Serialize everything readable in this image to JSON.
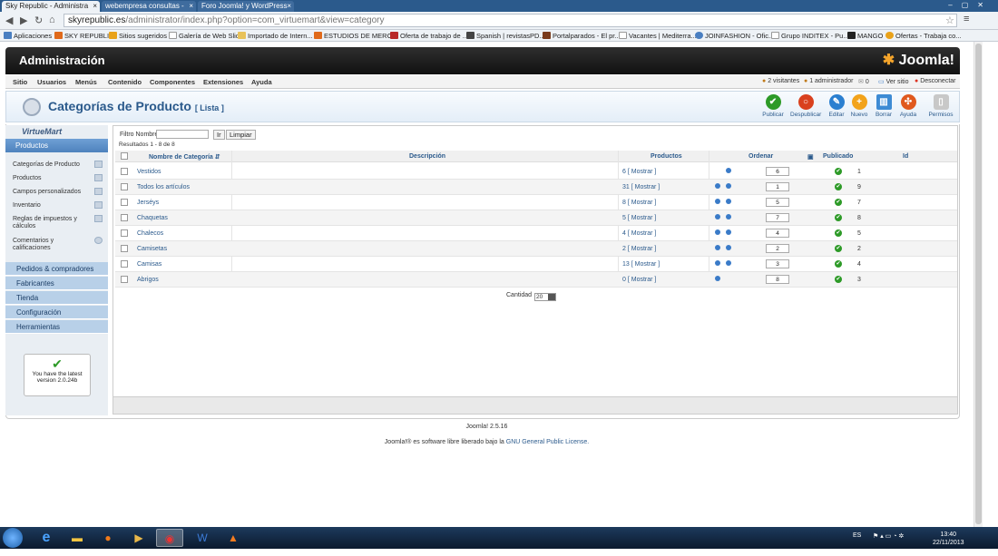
{
  "browser": {
    "tabs": [
      {
        "label": "Sky Republic - Administra",
        "active": true
      },
      {
        "label": "webempresa consultas - ",
        "active": false
      },
      {
        "label": "Foro Joomla! y WordPress",
        "active": false
      }
    ],
    "url_host": "skyrepublic.es",
    "url_path": "/administrator/index.php?option=com_virtuemart&view=category",
    "bookmarks": [
      "Aplicaciones",
      "SKY REPUBLIC",
      "Sitios sugeridos",
      "Galería de Web Slice",
      "Importado de Intern...",
      "ESTUDIOS DE MERC...",
      "Oferta de trabajo de ...",
      "Spanish | revistasPD...",
      "Portalparados - El pr...",
      "Vacantes | Mediterra...",
      "JOINFASHION - Ofic...",
      "Grupo INDITEX - Pu...",
      "MANGO",
      "Ofertas - Trabaja co..."
    ]
  },
  "header": {
    "title": "Administración",
    "logo": "Joomla!"
  },
  "menu": {
    "items": [
      "Sitio",
      "Usuarios",
      "Menús",
      "Contenido",
      "Componentes",
      "Extensiones",
      "Ayuda"
    ],
    "status": {
      "visitors": "2 visitantes",
      "admins": "1 administrador",
      "messages": "0",
      "view_site": "Ver sitio",
      "logout": "Desconectar"
    }
  },
  "toolbar": {
    "title": "Categorías de Producto",
    "subtitle": "[ Lista ]",
    "buttons": [
      "Publicar",
      "Despublicar",
      "Editar",
      "Nuevo",
      "Borrar",
      "Ayuda",
      "Permisos"
    ]
  },
  "sidebar": {
    "logo": "VirtueMart",
    "section_products": "Productos",
    "items": [
      "Categorías de Producto",
      "Productos",
      "Campos personalizados",
      "Inventario",
      "Reglas de impuestos y cálculos",
      "Comentarios y calificaciones"
    ],
    "sections": [
      "Pedidos & compradores",
      "Fabricantes",
      "Tienda",
      "Configuración",
      "Herramientas"
    ],
    "latest": "You have the latest version 2.0.24b"
  },
  "filter": {
    "label": "Filtro Nombre:",
    "go": "Ir",
    "clear": "Limpiar",
    "results": "Resultados 1 - 8 de 8"
  },
  "table": {
    "headers": {
      "name": "Nombre de Categoría",
      "description": "Descripción",
      "products": "Productos",
      "order": "Ordenar",
      "published": "Publicado",
      "id": "Id"
    },
    "rows": [
      {
        "name": "Vestidos",
        "products": "6",
        "show": "[ Mostrar ]",
        "order": "6",
        "id": "1"
      },
      {
        "name": "Todos los artículos",
        "products": "31",
        "show": "[ Mostrar ]",
        "order": "1",
        "id": "9"
      },
      {
        "name": "Jerséys",
        "products": "8",
        "show": "[ Mostrar ]",
        "order": "5",
        "id": "7"
      },
      {
        "name": "Chaquetas",
        "products": "5",
        "show": "[ Mostrar ]",
        "order": "7",
        "id": "8"
      },
      {
        "name": "Chalecos",
        "products": "4",
        "show": "[ Mostrar ]",
        "order": "4",
        "id": "5"
      },
      {
        "name": "Camisetas",
        "products": "2",
        "show": "[ Mostrar ]",
        "order": "2",
        "id": "2"
      },
      {
        "name": "Camisas",
        "products": "13",
        "show": "[ Mostrar ]",
        "order": "3",
        "id": "4"
      },
      {
        "name": "Abrigos",
        "products": "0",
        "show": "[ Mostrar ]",
        "order": "8",
        "id": "3"
      }
    ],
    "limit_label": "Cantidad",
    "limit_value": "20"
  },
  "footer": {
    "version": "Joomla! 2.5.16",
    "license_prefix": "Joomla!® es software libre liberado bajo la",
    "license_link": "GNU General Public License."
  },
  "taskbar": {
    "lang": "ES",
    "time": "13:40",
    "date": "22/11/2013"
  }
}
